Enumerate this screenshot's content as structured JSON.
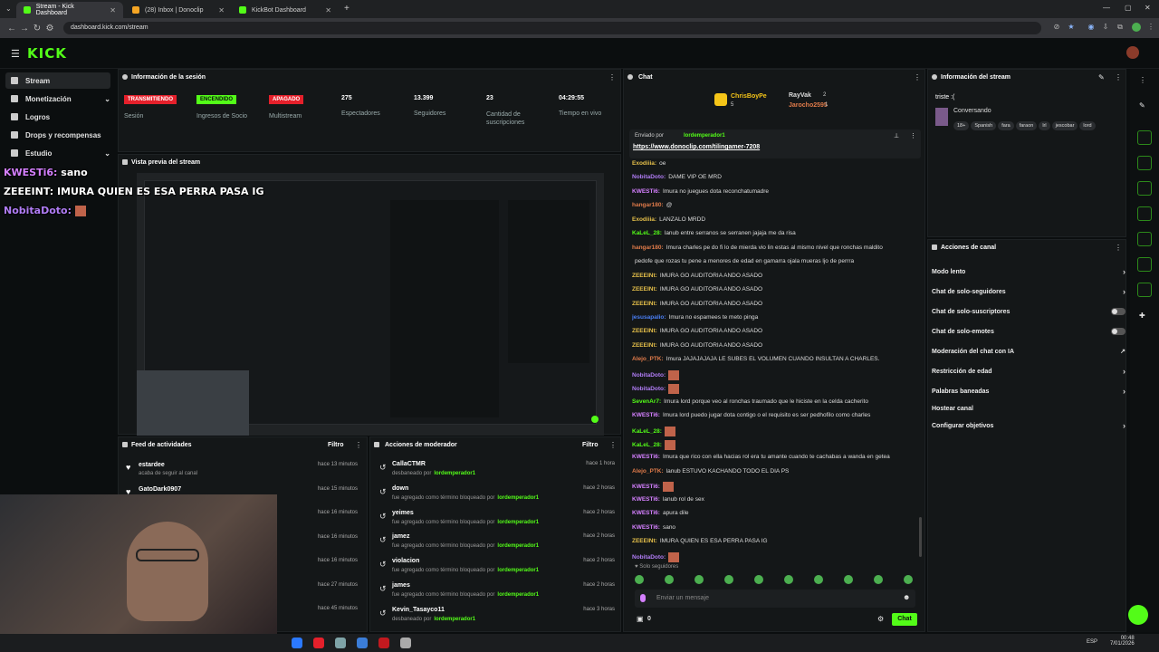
{
  "browser": {
    "tabs": [
      {
        "label": "Stream - Kick Dashboard",
        "active": true,
        "favicon": "kick-icon"
      },
      {
        "label": "(28) Inbox | Donoclip",
        "active": false,
        "favicon": "mail-icon"
      },
      {
        "label": "KickBot Dashboard",
        "active": false,
        "favicon": "kick-icon"
      }
    ],
    "url": "dashboard.kick.com/stream"
  },
  "brand": {
    "logo": "KICK",
    "accent": "#53fc18"
  },
  "sidebar": {
    "items": [
      {
        "label": "Stream",
        "selected": true
      },
      {
        "label": "Monetización"
      },
      {
        "label": "Logros"
      },
      {
        "label": "Drops y recompensas"
      },
      {
        "label": "Estudio"
      }
    ]
  },
  "session": {
    "title": "Información de la sesión",
    "badges": [
      {
        "text": "TRANSMITIENDO",
        "label": "Sesión",
        "color": "#e5202b"
      },
      {
        "text": "ENCENDIDO",
        "label": "Ingresos de Socio",
        "color": "#53fc18"
      },
      {
        "text": "APAGADO",
        "label": "Multistream",
        "color": "#e5202b"
      }
    ],
    "stats": [
      {
        "value": "275",
        "label": "Espectadores"
      },
      {
        "value": "13.399",
        "label": "Seguidores"
      },
      {
        "value": "23",
        "label": "Cantidad de suscripciones"
      },
      {
        "value": "04:29:55",
        "label": "Tiempo en vivo"
      }
    ]
  },
  "preview": {
    "title": "Vista previa del stream"
  },
  "overlay": {
    "line1_user": "KWESTi6:",
    "line1_msg": "sano",
    "line2": "ZEEEINT: IMURA QUIEN ES ESA PERRA PASA IG",
    "line3_user": "NobitaDoto:"
  },
  "activity": {
    "title": "Feed de actividades",
    "filter": "Filtro",
    "items": [
      {
        "user": "estardee",
        "desc": "acaba de seguir al canal",
        "time": "hace 13 minutos"
      },
      {
        "user": "GatoDark0907",
        "desc": "",
        "time": "hace 15 minutos"
      },
      {
        "user": "",
        "desc": "",
        "time": "hace 16 minutos"
      },
      {
        "user": "",
        "desc": "",
        "time": "hace 16 minutos"
      },
      {
        "user": "",
        "desc": "",
        "time": "hace 16 minutos"
      },
      {
        "user": "",
        "desc": "",
        "time": "hace 27 minutos"
      },
      {
        "user": "",
        "desc": "",
        "time": "hace 45 minutos"
      }
    ]
  },
  "modactions": {
    "title": "Acciones de moderador",
    "filter": "Filtro",
    "items": [
      {
        "term": "CallaCTMR",
        "desc": "desbaneado por",
        "mod": "lordemperador1",
        "time": "hace 1 hora"
      },
      {
        "term": "down",
        "desc": "fue agregado como término bloqueado por",
        "mod": "lordemperador1",
        "time": "hace 2 horas"
      },
      {
        "term": "yeimes",
        "desc": "fue agregado como término bloqueado por",
        "mod": "lordemperador1",
        "time": "hace 2 horas"
      },
      {
        "term": "jamez",
        "desc": "fue agregado como término bloqueado por",
        "mod": "lordemperador1",
        "time": "hace 2 horas"
      },
      {
        "term": "violacion",
        "desc": "fue agregado como término bloqueado por",
        "mod": "lordemperador1",
        "time": "hace 2 horas"
      },
      {
        "term": "james",
        "desc": "fue agregado como término bloqueado por",
        "mod": "lordemperador1",
        "time": "hace 2 horas"
      },
      {
        "term": "Kevin_Tasayco11",
        "desc": "desbaneado por",
        "mod": "lordemperador1",
        "time": "hace 3 horas"
      }
    ]
  },
  "chat": {
    "title": "Chat",
    "leaderboard": {
      "first": "ChrisBoyPe",
      "first_count": "5",
      "second": "RayVak",
      "second_count": "2",
      "third": "Jarocho2595",
      "third_count": "1"
    },
    "pinned_by_label": "Enviado por",
    "pinned_by": "lordemperador1",
    "pinned_link": "https://www.donoclip.com/tilingamer-7208",
    "messages": [
      {
        "user": "Exodiiia:",
        "msg": "oe",
        "color": "#e6c04a"
      },
      {
        "user": "NobitaDoto:",
        "msg": "DAME VIP OE MRD",
        "color": "#b07cf5"
      },
      {
        "user": "KWESTi6:",
        "msg": "Imura no juegues dota reconchatumadre",
        "color": "#d580ff"
      },
      {
        "user": "hangar180:",
        "msg": "@",
        "color": "#e07b4a"
      },
      {
        "user": "Exodiiia:",
        "msg": "LANZALO MRDD",
        "color": "#e6c04a"
      },
      {
        "user": "KaLeL_28:",
        "msg": "lanub entre serranos se serranen jajaja me da risa",
        "color": "#53fc18"
      },
      {
        "user": "hangar180:",
        "msg": "Imura charles pe do fi lo de mierda vio lin estas al mismo nivel que ronchas maldito",
        "color": "#e07b4a"
      },
      {
        "user": "",
        "msg": "pedofe que rozas tu pene a menores de edad en gamarra ojala mueras ljo de perrra",
        "color": "#e07b4a"
      },
      {
        "user": "ZEEEINt:",
        "msg": "IMURA GO AUDITORIA ANDO ASADO",
        "color": "#e6c04a"
      },
      {
        "user": "ZEEEINt:",
        "msg": "IMURA GO AUDITORIA ANDO ASADO",
        "color": "#e6c04a"
      },
      {
        "user": "ZEEEINt:",
        "msg": "IMURA GO AUDITORIA ANDO ASADO",
        "color": "#e6c04a"
      },
      {
        "user": "jesusapalio:",
        "msg": "Imura no espamees te meto pinga",
        "color": "#4a7ff5"
      },
      {
        "user": "ZEEEINt:",
        "msg": "IMURA GO AUDITORIA ANDO ASADO",
        "color": "#e6c04a"
      },
      {
        "user": "ZEEEINt:",
        "msg": "IMURA GO AUDITORIA ANDO ASADO",
        "color": "#e6c04a"
      },
      {
        "user": "Alejo_PTK:",
        "msg": "Imura JAJAJAJAJA LE SUBES EL VOLUMEN CUANDO INSULTAN A CHARLES.",
        "color": "#e07b4a"
      },
      {
        "user": "NobitaDoto:",
        "msg": "",
        "color": "#b07cf5"
      },
      {
        "user": "NobitaDoto:",
        "msg": "",
        "color": "#b07cf5"
      },
      {
        "user": "SevenAr7:",
        "msg": "Imura lord porque veo al ronchas traumado que le hiciste en la celda cacherito",
        "color": "#53fc18"
      },
      {
        "user": "KWESTi6:",
        "msg": "Imura lord puedo jugar dota contigo o el requisito es ser pedhofilo como charles",
        "color": "#d580ff"
      },
      {
        "user": "KaLeL_28:",
        "msg": "",
        "color": "#53fc18"
      },
      {
        "user": "KaLeL_28:",
        "msg": "",
        "color": "#53fc18"
      },
      {
        "user": "KWESTi6:",
        "msg": "Imura que rico con ella hacias rol era tu amante cuando te cachabas a wanda en getea",
        "color": "#d580ff"
      },
      {
        "user": "Alejo_PTK:",
        "msg": "lanub ESTUVO KACHANDO TODO EL DIA PS",
        "color": "#e07b4a"
      },
      {
        "user": "KWESTi6:",
        "msg": "",
        "color": "#d580ff"
      },
      {
        "user": "KWESTi6:",
        "msg": "lanub rol de sex",
        "color": "#d580ff"
      },
      {
        "user": "KWESTi6:",
        "msg": "apura dile",
        "color": "#d580ff"
      },
      {
        "user": "KWESTi6:",
        "msg": "sano",
        "color": "#d580ff"
      },
      {
        "user": "ZEEEINt:",
        "msg": "IMURA QUIEN ES ESA PERRA PASA IG",
        "color": "#e6c04a"
      },
      {
        "user": "NobitaDoto:",
        "msg": "",
        "color": "#b07cf5"
      }
    ],
    "followers_only": "Solo seguidores",
    "input_placeholder": "Enviar un mensaje",
    "points": "0",
    "send_label": "Chat"
  },
  "streaminfo": {
    "title": "Información del stream",
    "stream_title": "triste :(",
    "category": "Conversando",
    "tags": [
      "18+",
      "Spanish",
      "fara",
      "faraon",
      "lrl",
      "jescobar",
      "lord"
    ]
  },
  "channel_actions": {
    "title": "Acciones de canal",
    "items": [
      {
        "label": "Modo lento",
        "control": "chevron"
      },
      {
        "label": "Chat de solo-seguidores",
        "control": "chevron"
      },
      {
        "label": "Chat de solo-suscriptores",
        "control": "toggle"
      },
      {
        "label": "Chat de solo-emotes",
        "control": "toggle"
      },
      {
        "label": "Moderación del chat con IA",
        "control": "external"
      },
      {
        "label": "Restricción de edad",
        "control": "chevron"
      },
      {
        "label": "Palabras baneadas",
        "control": "chevron"
      },
      {
        "label": "Hostear canal",
        "control": "none"
      },
      {
        "label": "Configurar objetivos",
        "control": "chevron"
      }
    ]
  },
  "taskbar": {
    "lang": "ESP",
    "time": "00:48",
    "date": "7/01/2026"
  }
}
